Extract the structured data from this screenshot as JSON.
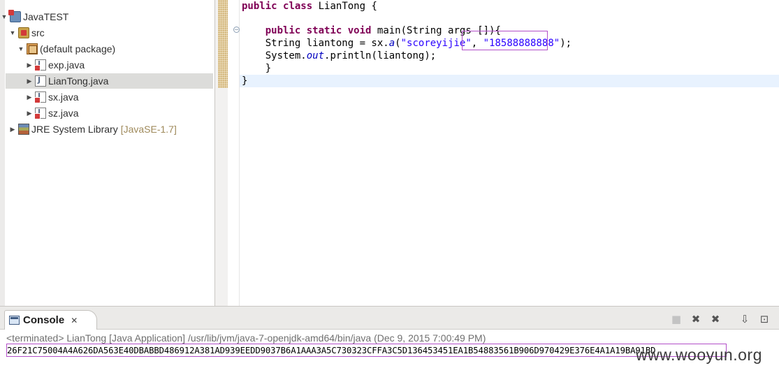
{
  "explorer": {
    "items": [
      {
        "label": "JavaTEST",
        "decoration": "",
        "twisty": "▼",
        "icon": "java-project-icon"
      },
      {
        "label": "src",
        "decoration": "",
        "twisty": "▼",
        "icon": "source-folder-icon"
      },
      {
        "label": "(default package)",
        "decoration": "",
        "twisty": "▼",
        "icon": "package-icon"
      },
      {
        "label": "exp.java",
        "decoration": "",
        "twisty": "▶",
        "icon": "java-file-error-icon"
      },
      {
        "label": "LianTong.java",
        "decoration": "",
        "twisty": "▶",
        "icon": "java-file-icon"
      },
      {
        "label": "sx.java",
        "decoration": "",
        "twisty": "▶",
        "icon": "java-file-error-icon"
      },
      {
        "label": "sz.java",
        "decoration": "",
        "twisty": "▶",
        "icon": "java-file-error-icon"
      },
      {
        "label": "JRE System Library",
        "decoration": "[JavaSE-1.7]",
        "twisty": "▶",
        "icon": "library-icon"
      }
    ],
    "selected_index": 4
  },
  "editor": {
    "line1": {
      "kw1": "public",
      "kw2": "class",
      "rest": " LianTong {"
    },
    "line2": {
      "kw1": "public",
      "kw2": "static",
      "kw3": "void",
      "rest": " main(String args []){"
    },
    "line3": {
      "prefix": "String liantong = sx.",
      "method": "a",
      "open": "(",
      "arg1": "\"scoreyijie\"",
      "comma": ", ",
      "arg2": "\"18588888888\"",
      "close": ");"
    },
    "line4": {
      "prefix": "System.",
      "field": "out",
      "rest": ".println(liantong);"
    },
    "line5": "}",
    "line6": "}",
    "fold_glyph": "−"
  },
  "console": {
    "tab_label": "Console",
    "tab_close": "✕",
    "status": "<terminated> LianTong [Java Application] /usr/lib/jvm/java-7-openjdk-amd64/bin/java (Dec 9, 2015 7:00:49 PM)",
    "output": "26F21C75004A4A626DA563E40DBABBD486912A381AD939EEDD9037B6A1AAA3A5C730323CFFA3C5D136453451EA1B54883561B906D970429E376E4A1A19BA91BD",
    "toolbar": {
      "terminate": "■",
      "remove": "✖",
      "remove_all": "✖",
      "scroll_lock": "⇩",
      "pin": "⊡"
    }
  },
  "watermark": "www.wooyun.org",
  "colors": {
    "keyword": "#7f0055",
    "string": "#2a00ff",
    "highlight_box": "#b24fc9"
  }
}
